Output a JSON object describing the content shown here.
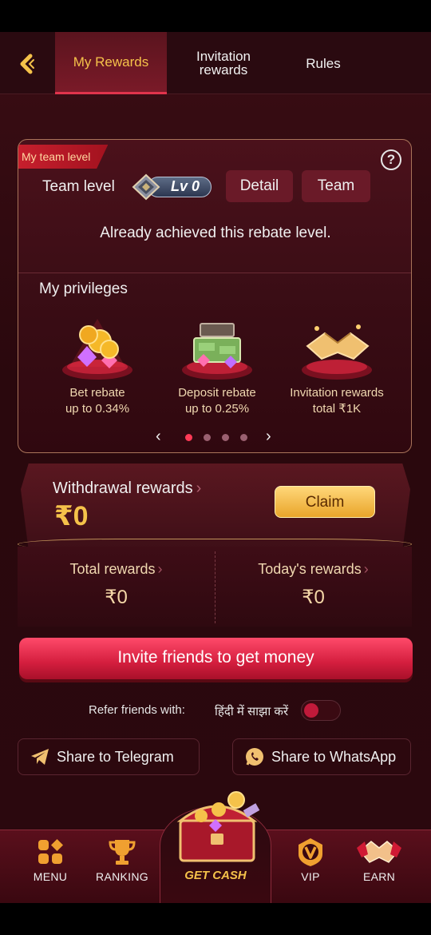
{
  "header": {
    "tabs": [
      {
        "label": "My Rewards",
        "active": true
      },
      {
        "label": "Invitation\nrewards",
        "active": false
      },
      {
        "label": "Rules",
        "active": false
      }
    ]
  },
  "team_card": {
    "ribbon": "My team level",
    "team_level_label": "Team level",
    "level_badge": "Lv 0",
    "detail_button": "Detail",
    "team_button": "Team",
    "achieved_text": "Already achieved this rebate level.",
    "privileges_title": "My privileges",
    "privileges": [
      {
        "line1": "Bet rebate",
        "line2": "up to 0.34%",
        "icon": "coins-gems-icon"
      },
      {
        "line1": "Deposit rebate",
        "line2": "up to 0.25%",
        "icon": "money-chest-icon"
      },
      {
        "line1": "Invitation rewards",
        "line2": "total ₹1K",
        "icon": "handshake-icon"
      }
    ],
    "pager": {
      "pages": 4,
      "active": 0
    }
  },
  "withdrawal": {
    "label": "Withdrawal rewards",
    "amount": "₹0",
    "claim_button": "Claim"
  },
  "totals": {
    "total_label": "Total rewards",
    "total_value": "₹0",
    "today_label": "Today's rewards",
    "today_value": "₹0"
  },
  "invite_button": "Invite friends to get money",
  "refer": {
    "label": "Refer friends with:",
    "hindi_label": "हिंदी में साझा करें",
    "toggle_on": false
  },
  "share": {
    "telegram": "Share to Telegram",
    "whatsapp": "Share to WhatsApp"
  },
  "nav": {
    "menu": "MENU",
    "ranking": "RANKING",
    "get_cash": "GET CASH",
    "vip": "VIP",
    "earn": "EARN"
  },
  "colors": {
    "accent_gold": "#f5c24a",
    "accent_red": "#e0344c",
    "background": "#2a080d"
  }
}
